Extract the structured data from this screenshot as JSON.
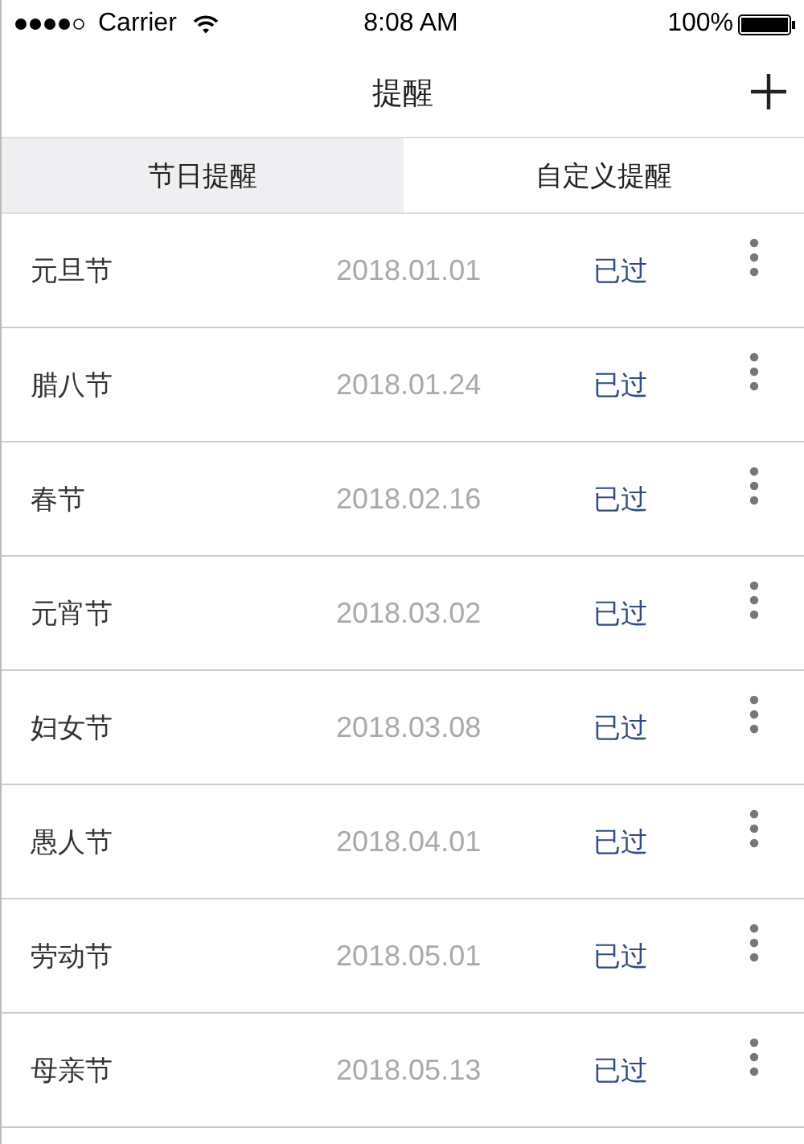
{
  "status_bar": {
    "carrier": "Carrier",
    "time": "8:08 AM",
    "battery": "100%"
  },
  "nav_bar": {
    "title": "提醒"
  },
  "tabs": [
    {
      "label": "节日提醒",
      "selected": true
    },
    {
      "label": "自定义提醒",
      "selected": false
    }
  ],
  "reminders": [
    {
      "name": "元旦节",
      "date": "2018.01.01",
      "status": "已过"
    },
    {
      "name": "腊八节",
      "date": "2018.01.24",
      "status": "已过"
    },
    {
      "name": "春节",
      "date": "2018.02.16",
      "status": "已过"
    },
    {
      "name": "元宵节",
      "date": "2018.03.02",
      "status": "已过"
    },
    {
      "name": "妇女节",
      "date": "2018.03.08",
      "status": "已过"
    },
    {
      "name": "愚人节",
      "date": "2018.04.01",
      "status": "已过"
    },
    {
      "name": "劳动节",
      "date": "2018.05.01",
      "status": "已过"
    },
    {
      "name": "母亲节",
      "date": "2018.05.13",
      "status": "已过"
    }
  ]
}
